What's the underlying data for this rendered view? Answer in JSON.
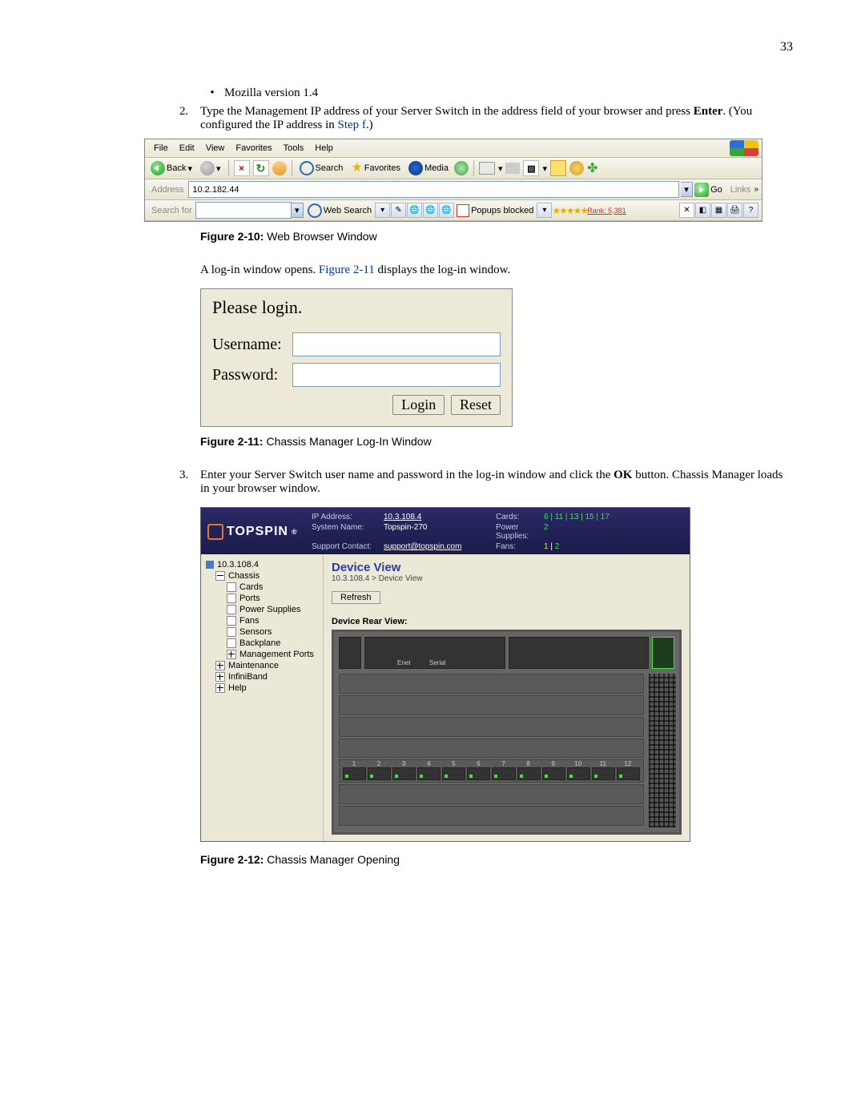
{
  "page_number": "33",
  "bullets": {
    "mozilla": "Mozilla version 1.4"
  },
  "step2": {
    "num": "2.",
    "text_a": "Type the Management IP address of your Server Switch in the address field of your browser and press ",
    "bold1": "Enter",
    "text_b": ". (You configured the IP address in ",
    "link": "Step f",
    "text_c": ".)"
  },
  "browser": {
    "menu": {
      "file": "File",
      "edit": "Edit",
      "view": "View",
      "favorites": "Favorites",
      "tools": "Tools",
      "help": "Help"
    },
    "toolbar": {
      "back": "Back",
      "search": "Search",
      "favorites": "Favorites",
      "media": "Media"
    },
    "address_label": "Address",
    "address_value": "10.2.182.44",
    "go": "Go",
    "links": "Links",
    "search_label": "Search for",
    "websearch": "Web Search",
    "popups": "Popups blocked",
    "rank": "Rank: 5,381"
  },
  "fig10": {
    "label": "Figure 2-10:",
    "caption": "Web Browser Window"
  },
  "afterFig10": {
    "a": "A log-in window opens. ",
    "link": "Figure 2-11",
    "b": " displays the log-in window."
  },
  "login": {
    "title": "Please login.",
    "username": "Username:",
    "password": "Password:",
    "login_btn": "Login",
    "reset_btn": "Reset"
  },
  "fig11": {
    "label": "Figure 2-11:",
    "caption": "Chassis Manager Log-In Window"
  },
  "step3": {
    "num": "3.",
    "a": "Enter your Server Switch user name and password in the log-in window and click the ",
    "bold": "OK",
    "b": " button. Chassis Manager loads in your browser window."
  },
  "cm": {
    "brand": "TOPSPIN",
    "info": {
      "ip_k": "IP Address:",
      "ip_v": "10.3.108.4",
      "sys_k": "System Name:",
      "sys_v": "Topspin-270",
      "sup_k": "Support Contact:",
      "sup_v": "support@topspin.com",
      "cards_k": "Cards:",
      "cards_v": "6 | 11 | 13 | 15 | 17",
      "ps_k": "Power Supplies:",
      "ps_v": "2",
      "fans_k": "Fans:",
      "fans_v": "1 | 2"
    },
    "tree": {
      "root": "10.3.108.4",
      "chassis": "Chassis",
      "cards": "Cards",
      "ports": "Ports",
      "psu": "Power Supplies",
      "fans": "Fans",
      "sensors": "Sensors",
      "backplane": "Backplane",
      "mgmt": "Management Ports",
      "maint": "Maintenance",
      "ib": "InfiniBand",
      "help": "Help"
    },
    "main": {
      "title": "Device View",
      "bc": "10.3.108.4 > Device View",
      "refresh": "Refresh",
      "rear": "Device Rear View:",
      "enet": "Enet",
      "serial": "Serial"
    },
    "portnums": [
      "1",
      "2",
      "3",
      "4",
      "5",
      "6",
      "7",
      "8",
      "9",
      "10",
      "11",
      "12"
    ]
  },
  "fig12": {
    "label": "Figure 2-12:",
    "caption": "Chassis Manager Opening"
  }
}
